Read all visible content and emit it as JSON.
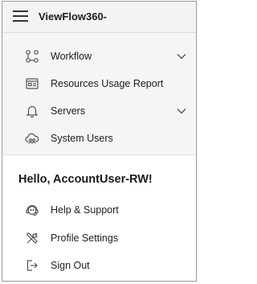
{
  "header": {
    "menu_icon": "hamburger-menu-icon",
    "app_title": "ViewFlow360-"
  },
  "nav": {
    "items": [
      {
        "label": "Workflow",
        "icon": "workflow-icon",
        "expandable": true
      },
      {
        "label": "Resources Usage Report",
        "icon": "report-icon",
        "expandable": false
      },
      {
        "label": "Servers",
        "icon": "bell-icon",
        "expandable": true
      },
      {
        "label": "System Users",
        "icon": "users-cloud-icon",
        "expandable": false
      }
    ]
  },
  "account": {
    "greeting": "Hello, AccountUser-RW!",
    "items": [
      {
        "label": "Help & Support",
        "icon": "support-icon"
      },
      {
        "label": "Profile Settings",
        "icon": "tools-icon"
      },
      {
        "label": "Sign Out",
        "icon": "sign-out-icon"
      }
    ]
  }
}
